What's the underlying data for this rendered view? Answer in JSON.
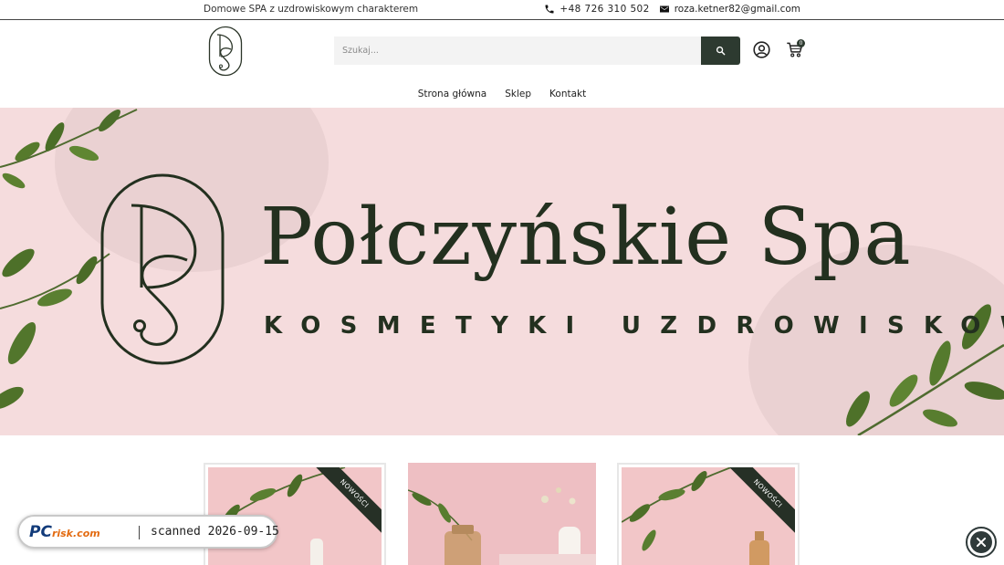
{
  "topbar": {
    "tagline": "Domowe SPA z uzdrowiskowym charakterem",
    "phone": "+48 726 310 502",
    "email": "roza.ketner82@gmail.com"
  },
  "header": {
    "search_placeholder": "Szukaj...",
    "cart_count": "0"
  },
  "nav": {
    "items": [
      {
        "label": "Strona główna"
      },
      {
        "label": "Sklep"
      },
      {
        "label": "Kontakt"
      }
    ]
  },
  "hero": {
    "title": "Połczyńskie Spa",
    "subtitle": "KOSMETYKI UZDROWISKOWE"
  },
  "products": {
    "badge": "NOWOŚCI"
  },
  "watermark": {
    "brand": "PC",
    "brand_suffix": "risk.com",
    "scanned": "scanned 2026-09-15"
  },
  "colors": {
    "brand_dark": "#2d3a30",
    "hero_bg": "#f5dcdd",
    "text_dark": "#23301f"
  }
}
